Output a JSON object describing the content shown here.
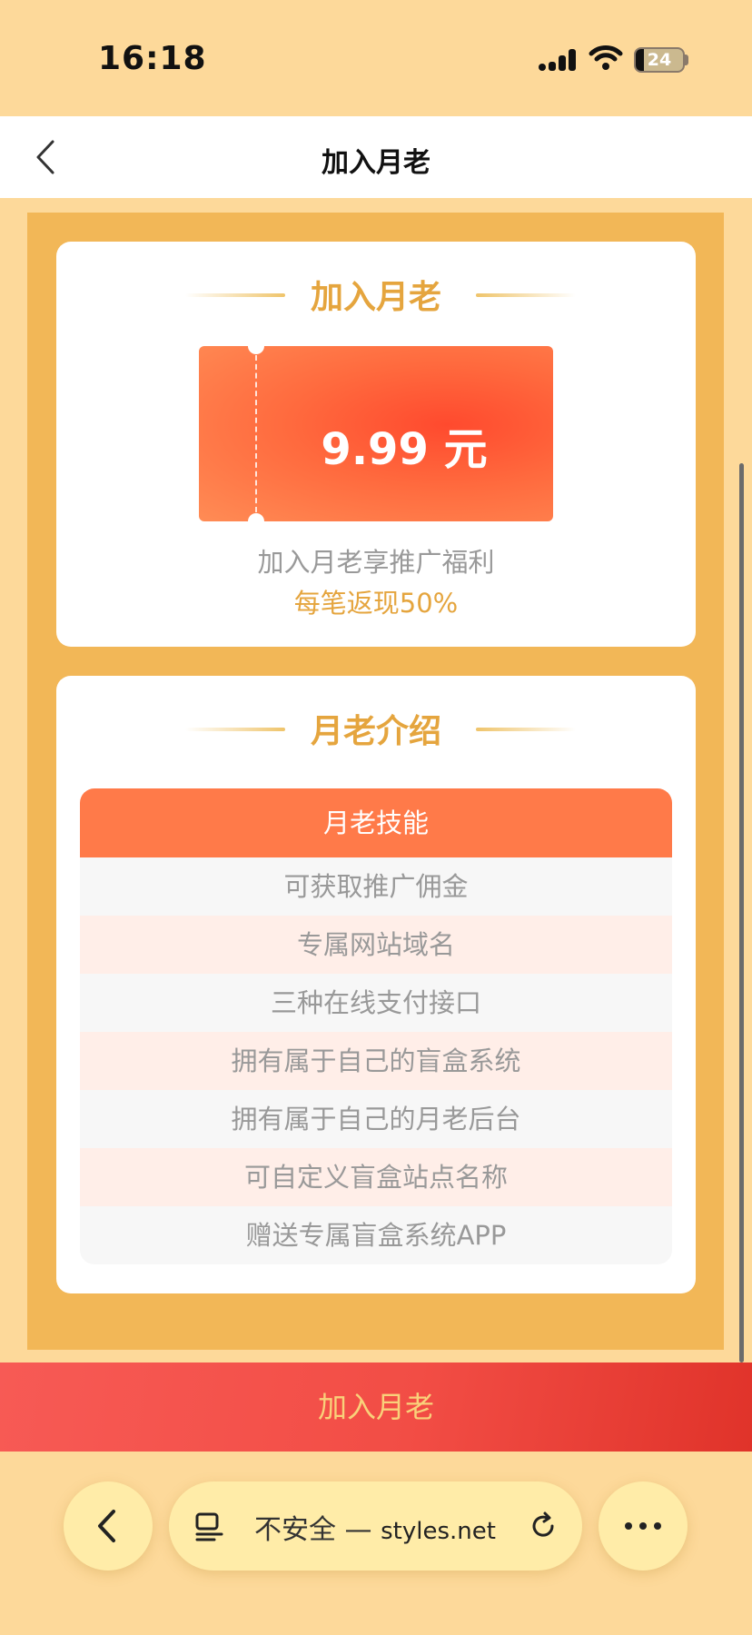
{
  "status_bar": {
    "time": "16:18",
    "battery": "24"
  },
  "nav": {
    "title": "加入月老"
  },
  "join_card": {
    "heading": "加入月老",
    "price": "9.99 元",
    "promo_text": "加入月老享推广福利",
    "rebate_text": "每笔返现50%"
  },
  "intro_card": {
    "heading": "月老介绍",
    "table_header": "月老技能",
    "skills": [
      "可获取推广佣金",
      "专属网站域名",
      "三种在线支付接口",
      "拥有属于自己的盲盒系统",
      "拥有属于自己的月老后台",
      "可自定义盲盒站点名称",
      "赠送专属盲盒系统APP"
    ]
  },
  "join_button": {
    "label": "加入月老"
  },
  "browser": {
    "security_label": "不安全 —",
    "domain": "styles.net",
    "icons": [
      "back-icon",
      "reader-icon",
      "reload-icon",
      "more-icon"
    ]
  },
  "colors": {
    "page_bg": "#FDD99A",
    "panel": "#F2B757",
    "accent_gold": "#E5A53E",
    "ticket_red": "#FF4A2E",
    "table_header": "#FF7A49",
    "button_red": "#F24D45"
  }
}
